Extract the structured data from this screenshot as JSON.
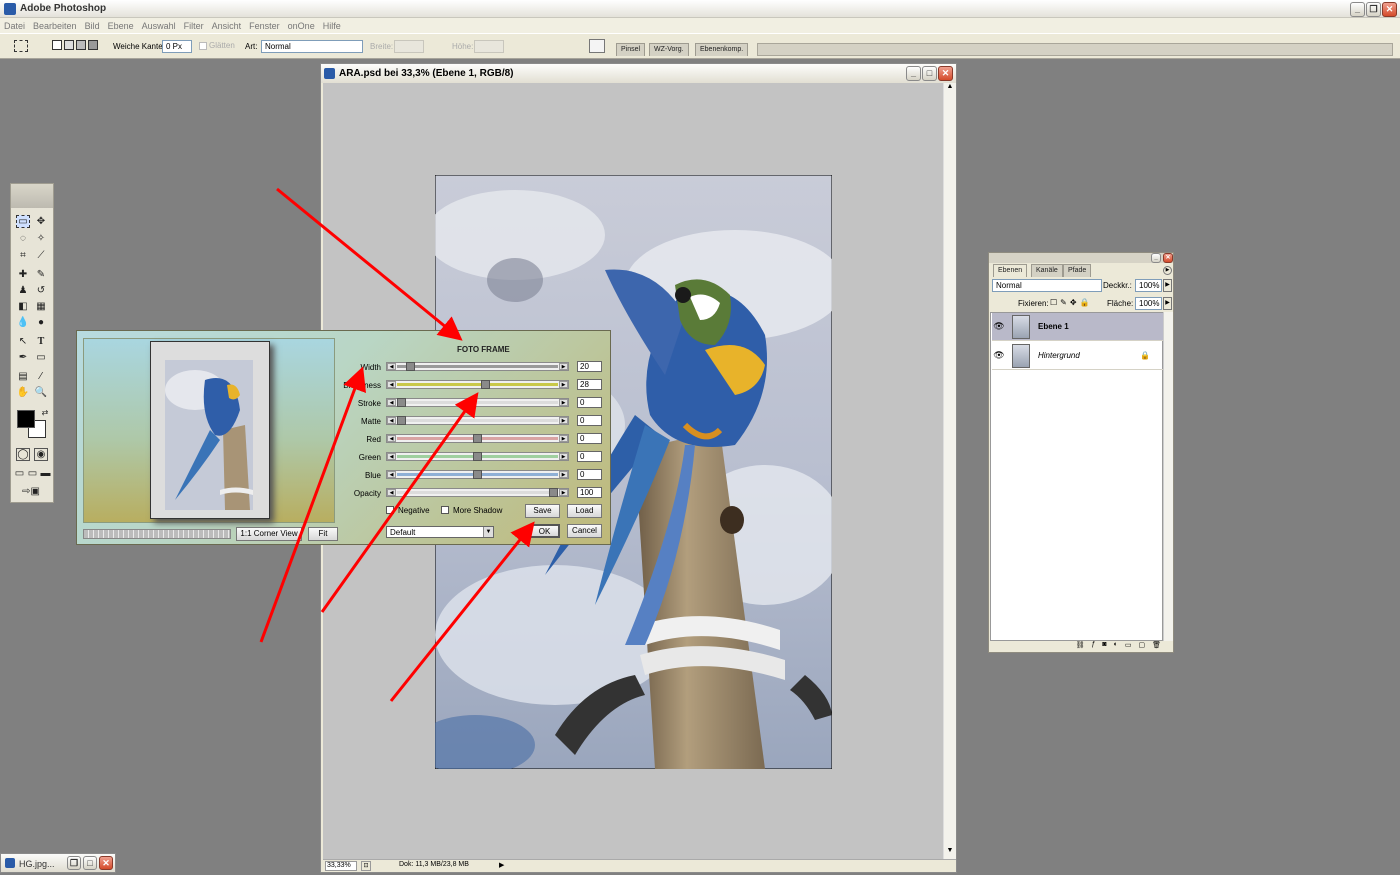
{
  "app": {
    "title": "Adobe Photoshop"
  },
  "menu": [
    "Datei",
    "Bearbeiten",
    "Bild",
    "Ebene",
    "Auswahl",
    "Filter",
    "Ansicht",
    "Fenster",
    "onOne",
    "Hilfe"
  ],
  "options": {
    "feather_label": "Weiche Kante:",
    "feather_value": "0 Px",
    "antialias_label": "Glätten",
    "style_label": "Art:",
    "style_value": "Normal",
    "width_label": "Breite:",
    "height_label": "Höhe:",
    "palette_tabs": [
      "Pinsel",
      "WZ-Vorg.",
      "Ebenenkomp."
    ]
  },
  "document": {
    "title": "ARA.psd bei 33,3% (Ebene 1, RGB/8)",
    "zoom": "33,33%",
    "doc_info": "Dok: 11,3 MB/23,8 MB"
  },
  "dialog": {
    "title": "FOTO FRAME",
    "sliders": [
      {
        "label": "Width",
        "value": "20",
        "pos": 0.06,
        "lane": "#9a9a9a"
      },
      {
        "label": "Brightness",
        "value": "28",
        "pos": 0.55,
        "lane": "#c9c84a"
      },
      {
        "label": "Stroke",
        "value": "0",
        "pos": 0.0,
        "lane": "#dcdcdc"
      },
      {
        "label": "Matte",
        "value": "0",
        "pos": 0.0,
        "lane": "#dcdcdc"
      },
      {
        "label": "Red",
        "value": "0",
        "pos": 0.5,
        "lane": "#d9a3a3"
      },
      {
        "label": "Green",
        "value": "0",
        "pos": 0.5,
        "lane": "#9fcf9f"
      },
      {
        "label": "Blue",
        "value": "0",
        "pos": 0.5,
        "lane": "#8fb0d6"
      },
      {
        "label": "Opacity",
        "value": "100",
        "pos": 1.0,
        "lane": "#dcdcdc"
      }
    ],
    "negative_label": "Negative",
    "more_shadow_label": "More Shadow",
    "save_label": "Save",
    "load_label": "Load",
    "ok_label": "OK",
    "cancel_label": "Cancel",
    "preset_value": "Default",
    "corner_view_label": "1:1 Corner View",
    "fit_label": "Fit"
  },
  "layers_panel": {
    "tabs": [
      "Ebenen",
      "Kanäle",
      "Pfade"
    ],
    "blend_mode": "Normal",
    "opacity_label": "Deckkr.:",
    "opacity_value": "100%",
    "lock_label": "Fixieren:",
    "fill_label": "Fläche:",
    "fill_value": "100%",
    "layers": [
      {
        "name": "Ebene 1",
        "selected": true
      },
      {
        "name": "Hintergrund",
        "selected": false
      }
    ]
  },
  "minimized_window": {
    "title": "HG.jpg..."
  },
  "colors": {
    "annotation_arrow": "#ff0000",
    "workspace": "#808080"
  }
}
